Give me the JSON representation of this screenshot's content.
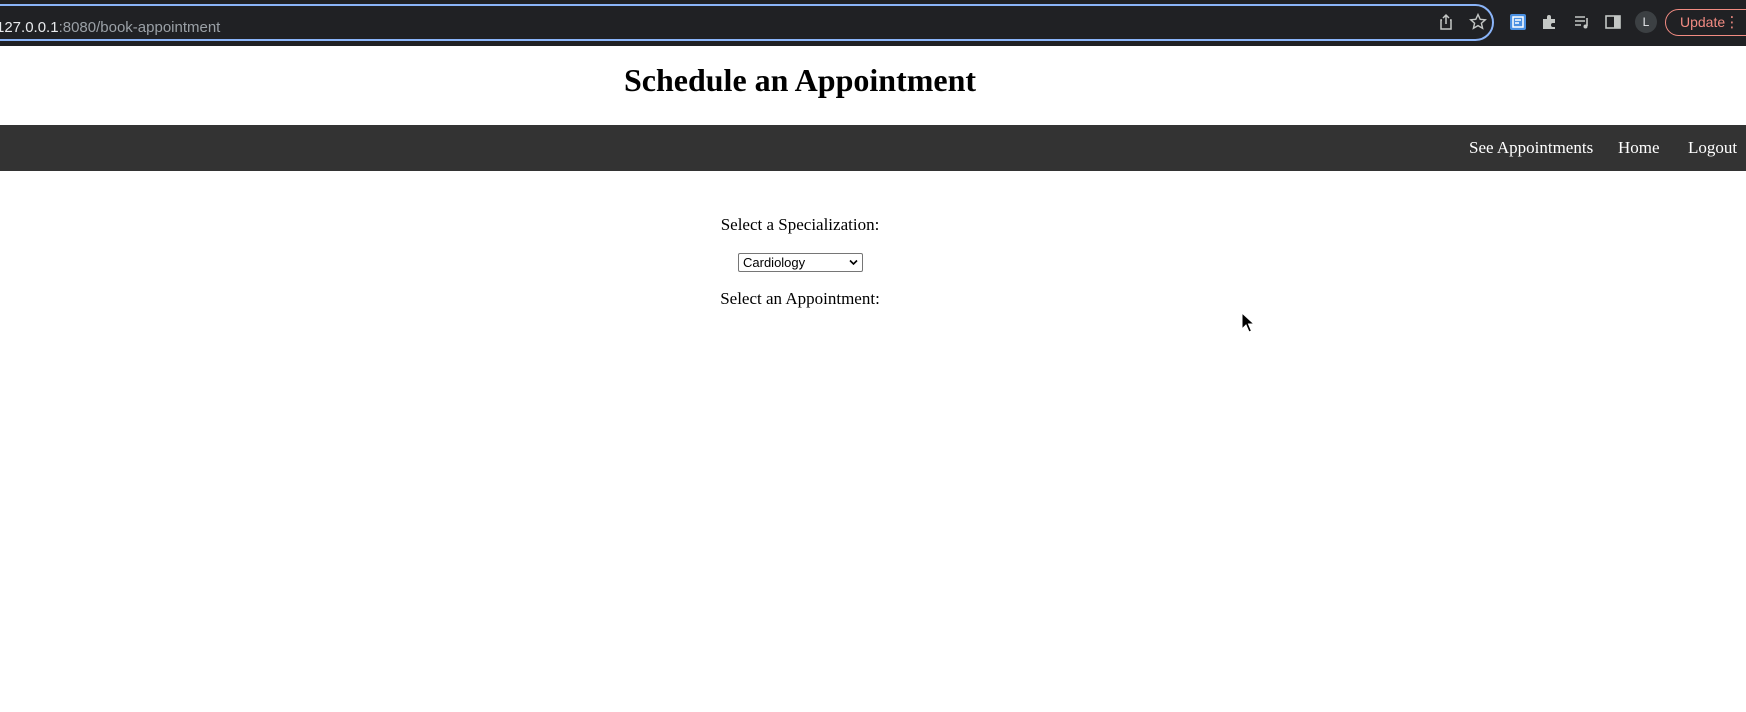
{
  "browser": {
    "url_host": "127.0.0.1",
    "url_rest": ":8080/book-appointment",
    "avatar_letter": "L",
    "update_label": "Update",
    "kebab_glyph": "⋮"
  },
  "page": {
    "title": "Schedule an Appointment"
  },
  "nav": {
    "links": [
      "See Appointments",
      "Home",
      "Logout"
    ]
  },
  "form": {
    "specialization_label": "Select a Specialization:",
    "specialization_value": "Cardiology",
    "appointment_label": "Select an Appointment:"
  },
  "colors": {
    "navbar": "#333333",
    "chrome": "#202124",
    "accent": "#8ab4f8",
    "update": "#f28b82"
  }
}
